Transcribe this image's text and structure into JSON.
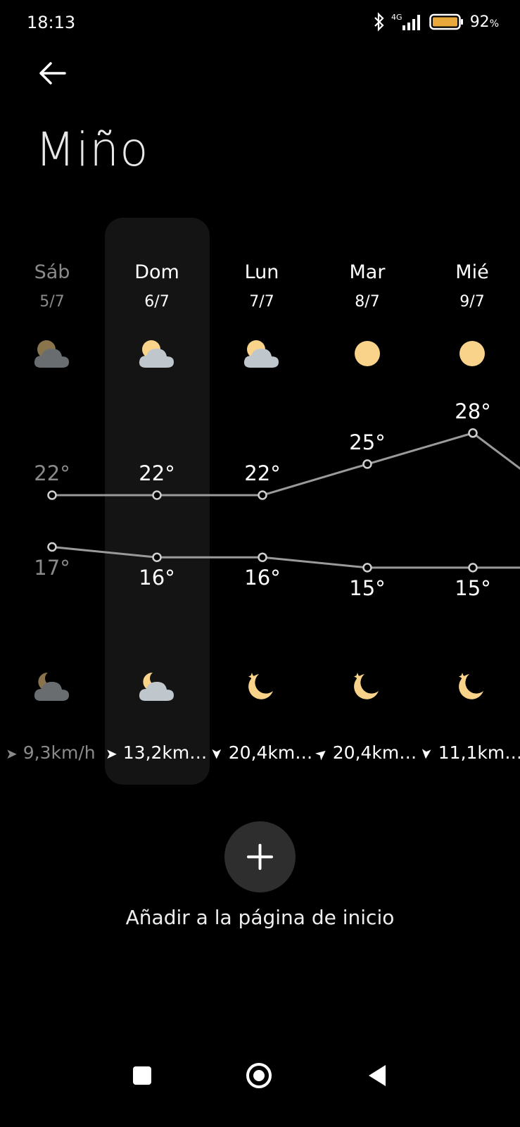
{
  "status": {
    "time": "18:13",
    "network": "4G",
    "battery_pct": "92",
    "battery_unit": "%"
  },
  "header": {
    "back_icon": "arrow-left-icon",
    "title": "Miño"
  },
  "days": [
    {
      "name": "Sáb",
      "date": "5/7",
      "day_icon": "partly-cloudy-icon",
      "high": "22°",
      "low": "17°",
      "night_icon": "cloudy-night-icon",
      "wind": "9,3km/h",
      "wind_dir": "east"
    },
    {
      "name": "Dom",
      "date": "6/7",
      "day_icon": "partly-cloudy-icon",
      "high": "22°",
      "low": "16°",
      "night_icon": "cloudy-night-icon",
      "wind": "13,2km…",
      "wind_dir": "east"
    },
    {
      "name": "Lun",
      "date": "7/7",
      "day_icon": "partly-cloudy-icon",
      "high": "22°",
      "low": "16°",
      "night_icon": "clear-night-icon",
      "wind": "20,4km…",
      "wind_dir": "south"
    },
    {
      "name": "Mar",
      "date": "8/7",
      "day_icon": "sunny-icon",
      "high": "25°",
      "low": "15°",
      "night_icon": "clear-night-icon",
      "wind": "20,4km…",
      "wind_dir": "northeast"
    },
    {
      "name": "Mié",
      "date": "9/7",
      "day_icon": "sunny-icon",
      "high": "28°",
      "low": "15°",
      "night_icon": "clear-night-icon",
      "wind": "11,1km…",
      "wind_dir": "south"
    }
  ],
  "chart_data": {
    "type": "line",
    "categories": [
      "5/7",
      "6/7",
      "7/7",
      "8/7",
      "9/7"
    ],
    "series": [
      {
        "values": [
          22,
          22,
          22,
          25,
          28
        ]
      },
      {
        "values": [
          17,
          16,
          16,
          15,
          15
        ]
      }
    ]
  },
  "actions": {
    "add_label": "Añadir a la página de inicio"
  },
  "colors": {
    "sun": "#FAD38A",
    "cloud": "#BFC6CC",
    "line": "#9a9a9a",
    "highlight": "#141414"
  }
}
